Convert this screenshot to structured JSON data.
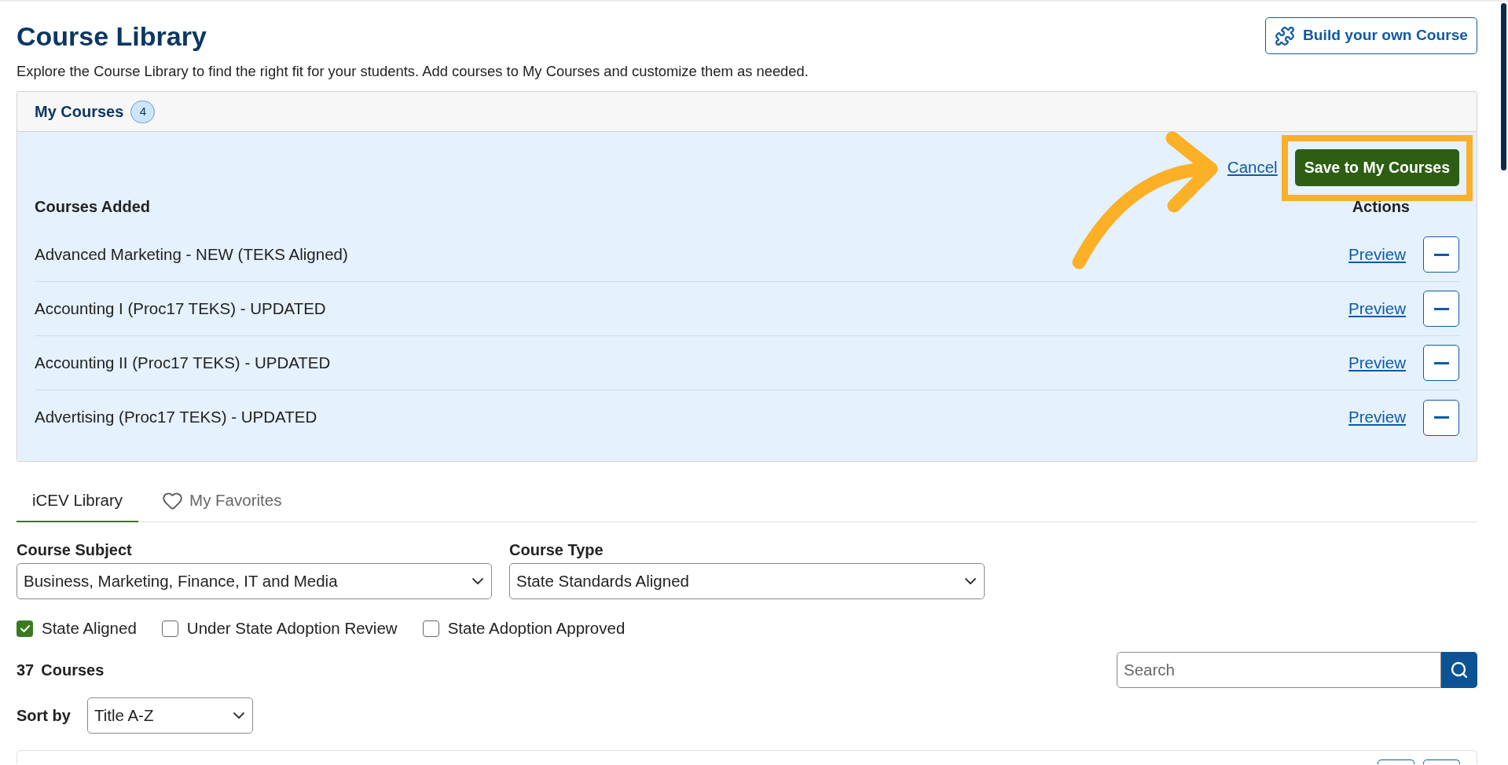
{
  "page": {
    "title": "Course Library",
    "description": "Explore the Course Library to find the right fit for your students. Add courses to My Courses and customize them as needed.",
    "build_button": "Build your own Course"
  },
  "my_courses": {
    "title": "My Courses",
    "count": "4",
    "cancel": "Cancel",
    "save": {
      "label": "Save to My Courses",
      "highlighted": true
    },
    "columns": [
      "Courses Added",
      "Actions"
    ],
    "rows": [
      {
        "title": "Advanced Marketing - NEW (TEKS Aligned)",
        "preview": "Preview"
      },
      {
        "title": "Accounting I (Proc17 TEKS) - UPDATED",
        "preview": "Preview"
      },
      {
        "title": "Accounting II (Proc17 TEKS) - UPDATED",
        "preview": "Preview"
      },
      {
        "title": "Advertising (Proc17 TEKS) - UPDATED",
        "preview": "Preview"
      }
    ]
  },
  "tabs": [
    {
      "label": "iCEV Library",
      "selected": true,
      "kind": "text"
    },
    {
      "label": "My Favorites",
      "selected": false,
      "kind": "favorites"
    }
  ],
  "filters": [
    {
      "label": "Course Subject",
      "value": "Business, Marketing, Finance, IT and Media"
    },
    {
      "label": "Course Type",
      "value": "State Standards Aligned"
    }
  ],
  "checkboxes": [
    {
      "label": "State Aligned",
      "checked": true
    },
    {
      "label": "Under State Adoption Review",
      "checked": false
    },
    {
      "label": "State Adoption Approved",
      "checked": false
    }
  ],
  "results": {
    "count": "37",
    "label": "Courses"
  },
  "search": {
    "placeholder": "Search"
  },
  "sort": {
    "label": "Sort by",
    "value": "Title A-Z"
  }
}
